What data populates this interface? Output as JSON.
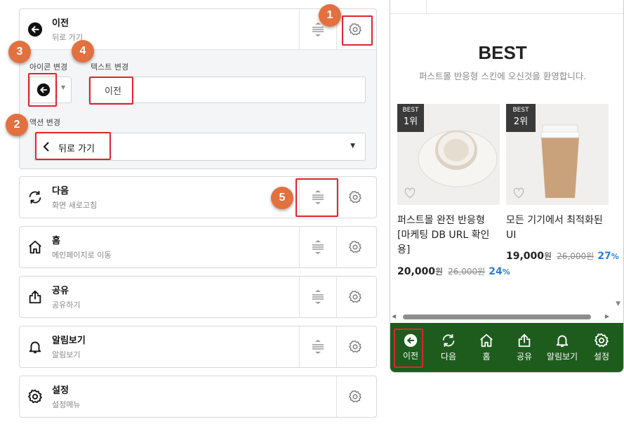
{
  "editor": {
    "selected": {
      "title": "이전",
      "subtitle": "뒤로 가기",
      "icon_label": "아이콘 변경",
      "text_label": "텍스트 변경",
      "text_value": "이전",
      "action_label": "액션 변경",
      "action_value": "뒤로 가기",
      "icon": "arrow-left-circle-icon"
    },
    "items": [
      {
        "title": "다음",
        "subtitle": "화면 새로고침",
        "icon": "refresh-icon"
      },
      {
        "title": "홈",
        "subtitle": "메인페이지로 이동",
        "icon": "home-icon"
      },
      {
        "title": "공유",
        "subtitle": "공유하기",
        "icon": "share-icon"
      },
      {
        "title": "알림보기",
        "subtitle": "알림보기",
        "icon": "bell-icon"
      },
      {
        "title": "설정",
        "subtitle": "설정메뉴",
        "icon": "settings-icon"
      }
    ],
    "badges": [
      "1",
      "2",
      "3",
      "4",
      "5"
    ],
    "badge_color": "#e3703f",
    "highlight_color": "#e0242c"
  },
  "preview": {
    "heading": "BEST",
    "tagline": "퍼스트몰 반응형 스킨에 오신것을 환영합니다.",
    "products": [
      {
        "badge_top": "BEST",
        "badge_rank": "1위",
        "name": "퍼스트몰 완전 반응형 [마케팅 DB URL 확인용]",
        "price": "20,000",
        "unit": "원",
        "old_price": "26,000원",
        "discount": "24",
        "pct": "%"
      },
      {
        "badge_top": "BEST",
        "badge_rank": "2위",
        "name": "모든 기기에서 최적화된 UI",
        "price": "19,000",
        "unit": "원",
        "old_price": "26,000원",
        "discount": "27",
        "pct": "%"
      }
    ],
    "bottom_bar": {
      "color": "#1e5c1e",
      "items": [
        {
          "label": "이전",
          "icon": "arrow-left-circle-icon"
        },
        {
          "label": "다음",
          "icon": "refresh-icon"
        },
        {
          "label": "홈",
          "icon": "home-icon"
        },
        {
          "label": "공유",
          "icon": "share-icon"
        },
        {
          "label": "알림보기",
          "icon": "bell-icon"
        },
        {
          "label": "설정",
          "icon": "settings-icon"
        }
      ]
    }
  }
}
